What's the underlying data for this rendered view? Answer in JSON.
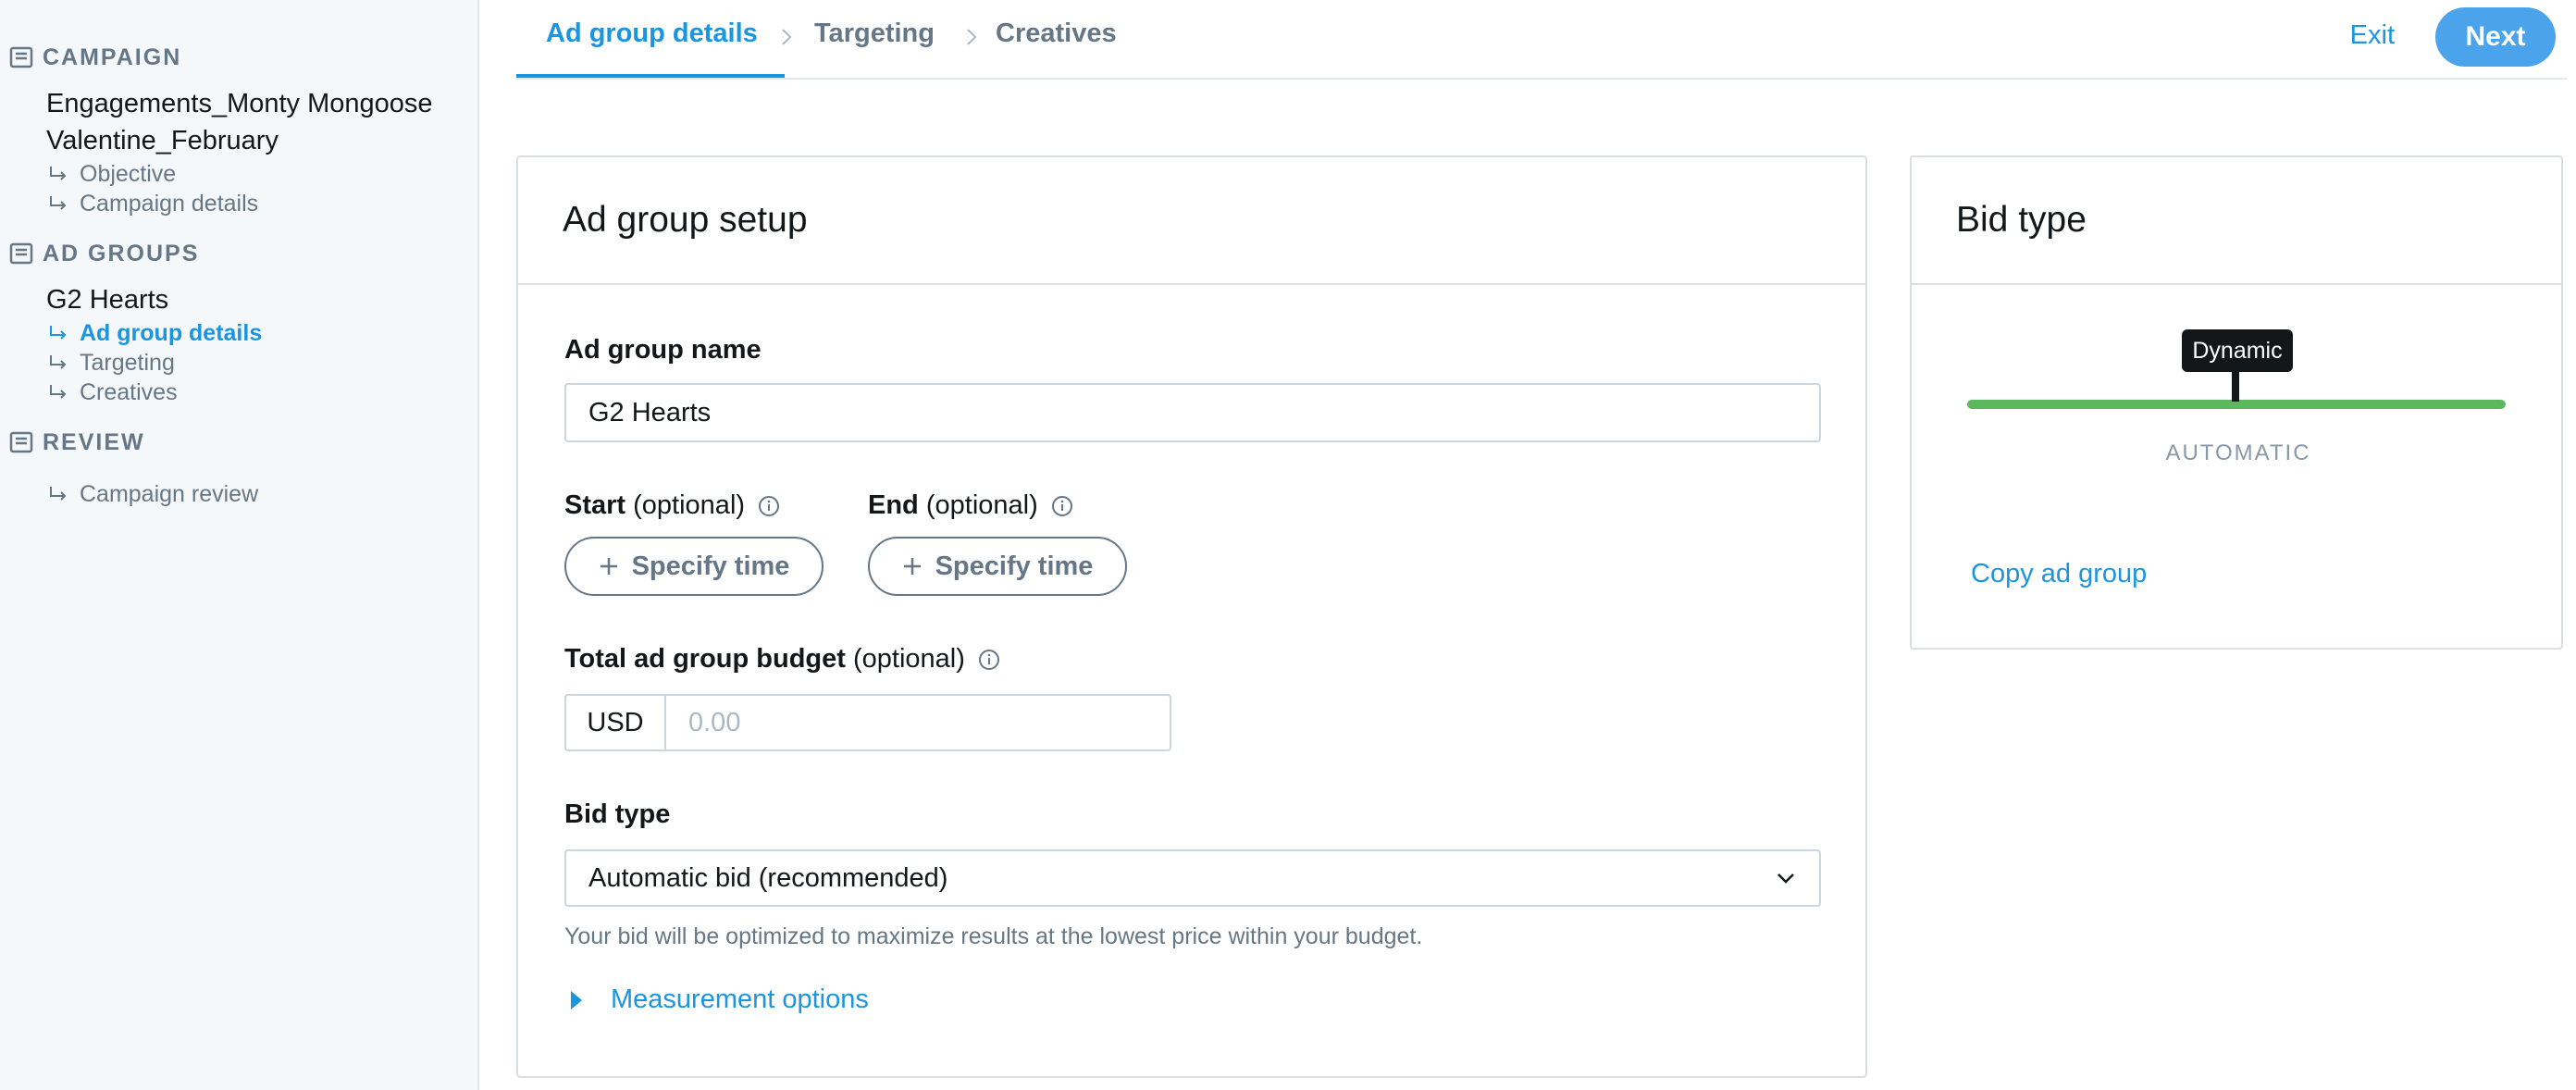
{
  "sidebar": {
    "campaign_heading": "CAMPAIGN",
    "campaign_name_line1": "Engagements_Monty Mongoose",
    "campaign_name_line2": "Valentine_February",
    "campaign_items": [
      "Objective",
      "Campaign details"
    ],
    "ad_groups_heading": "AD GROUPS",
    "ad_group_name": "G2 Hearts",
    "ad_group_items": [
      "Ad group details",
      "Targeting",
      "Creatives"
    ],
    "active_item": "Ad group details",
    "review_heading": "REVIEW",
    "review_items": [
      "Campaign review"
    ]
  },
  "topnav": {
    "steps": [
      "Ad group details",
      "Targeting",
      "Creatives"
    ],
    "active_step": "Ad group details",
    "exit_label": "Exit",
    "next_label": "Next"
  },
  "setup": {
    "title": "Ad group setup",
    "name_label": "Ad group name",
    "name_value": "G2 Hearts",
    "start_label": "Start",
    "end_label": "End",
    "optional_text": "(optional)",
    "specify_time_label": "Specify time",
    "budget_label": "Total ad group budget",
    "currency": "USD",
    "budget_placeholder": "0.00",
    "bid_type_label": "Bid type",
    "bid_type_value": "Automatic bid (recommended)",
    "bid_hint": "Your bid will be optimized to maximize results at the lowest price within your budget.",
    "measurement_label": "Measurement options"
  },
  "bid_panel": {
    "title": "Bid type",
    "tooltip": "Dynamic",
    "scale_label": "AUTOMATIC",
    "copy_label": "Copy ad group"
  },
  "colors": {
    "accent": "#1b95e0",
    "next_button": "#4ba3ec",
    "slider": "#5cb85c"
  },
  "icons": [
    "document-icon",
    "return-arrow-icon",
    "chevron-right-icon",
    "info-icon",
    "plus-icon",
    "chevron-down-icon",
    "caret-right-icon"
  ]
}
